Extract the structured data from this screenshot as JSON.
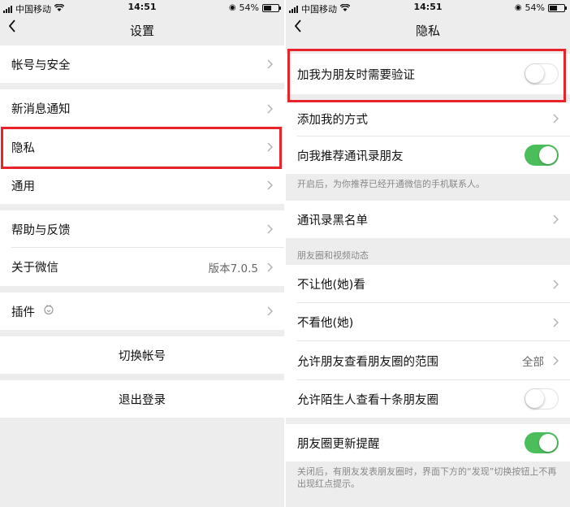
{
  "status": {
    "carrier": "中国移动",
    "time": "14:51",
    "battery": "54%"
  },
  "left": {
    "title": "设置",
    "items": {
      "account": "帐号与安全",
      "notify": "新消息通知",
      "privacy": "隐私",
      "general": "通用",
      "help": "帮助与反馈",
      "about": "关于微信",
      "about_value": "版本7.0.5",
      "plugins": "插件",
      "switch_account": "切换帐号",
      "logout": "退出登录"
    }
  },
  "right": {
    "title": "隐私",
    "items": {
      "verify": "加我为朋友时需要验证",
      "add_methods": "添加我的方式",
      "recommend": "向我推荐通讯录朋友",
      "recommend_note": "开启后，为你推荐已经开通微信的手机联系人。",
      "blacklist": "通讯录黑名单",
      "moments_header": "朋友圈和视频动态",
      "dont_let": "不让他(她)看",
      "dont_see": "不看他(她)",
      "range": "允许朋友查看朋友圈的范围",
      "range_value": "全部",
      "stranger": "允许陌生人查看十条朋友圈",
      "update_remind": "朋友圈更新提醒",
      "update_note": "关闭后，有朋友发表朋友圈时，界面下方的“发现”切换按钮上不再出现红点提示。"
    },
    "toggles": {
      "verify": false,
      "recommend": true,
      "stranger": false,
      "update_remind": true
    }
  },
  "colors": {
    "highlight": "#e8232a",
    "toggle_on": "#4cbd5b",
    "background": "#ededed"
  }
}
